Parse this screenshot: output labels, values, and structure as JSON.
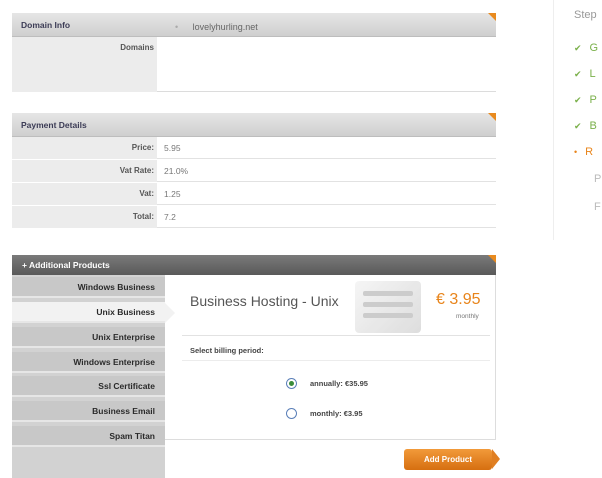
{
  "domain_info": {
    "title": "Domain Info",
    "label": "Domains",
    "domain_name": "lovelyhurling.net"
  },
  "payment_details": {
    "title": "Payment Details",
    "rows": [
      {
        "label": "Price:",
        "value": "5.95"
      },
      {
        "label": "Vat Rate:",
        "value": "21.0%"
      },
      {
        "label": "Vat:",
        "value": "1.25"
      },
      {
        "label": "Total:",
        "value": "7.2"
      }
    ]
  },
  "additional_products": {
    "title": "+ Additional Products",
    "items": [
      "Windows Business",
      "Unix Business",
      "Unix Enterprise",
      "Windows Enterprise",
      "Ssl Certificate",
      "Business Email",
      "Spam Titan"
    ],
    "active_index": 1,
    "product": {
      "name": "Business Hosting - Unix",
      "price": "€ 3.95",
      "per": "monthly"
    },
    "billing_label": "Select billing period:",
    "billing_options": [
      {
        "label": "annually: €35.95",
        "checked": true
      },
      {
        "label": "monthly: €3.95",
        "checked": false
      }
    ],
    "add_button": "Add Product"
  },
  "steps": {
    "title": "Step",
    "items": [
      {
        "mark": "✔",
        "label": "G",
        "state": "done"
      },
      {
        "mark": "✔",
        "label": "L",
        "state": "done"
      },
      {
        "mark": "✔",
        "label": "P",
        "state": "done"
      },
      {
        "mark": "✔",
        "label": "B",
        "state": "done"
      },
      {
        "mark": "•",
        "label": "R",
        "state": "current"
      },
      {
        "mark": "",
        "label": "P",
        "state": "pending"
      },
      {
        "mark": "",
        "label": "F",
        "state": "pending"
      }
    ]
  },
  "colors": {
    "accent_orange": "#e8841a",
    "step_done_green": "#7ab04a",
    "header_dark": "#595959"
  }
}
